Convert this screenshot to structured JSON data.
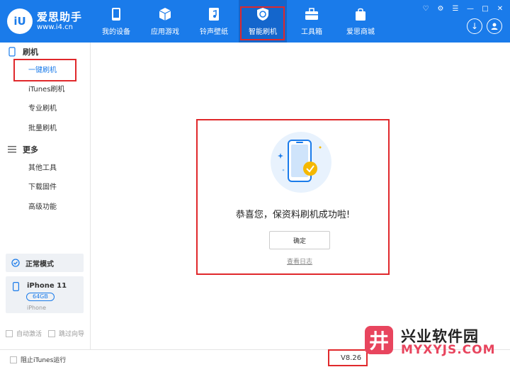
{
  "header": {
    "logo_text": "iU",
    "brand_name": "爱思助手",
    "brand_url": "www.i4.cn",
    "nav": [
      {
        "label": "我的设备",
        "icon": "apple-icon"
      },
      {
        "label": "应用游戏",
        "icon": "cube-icon"
      },
      {
        "label": "铃声壁纸",
        "icon": "music-file-icon"
      },
      {
        "label": "智能刷机",
        "icon": "refresh-shield-icon"
      },
      {
        "label": "工具箱",
        "icon": "toolbox-icon"
      },
      {
        "label": "爱思商城",
        "icon": "shopping-bag-icon"
      }
    ],
    "active_nav": "智能刷机",
    "accent_color": "#1a7bea"
  },
  "sidebar": {
    "section_flash": "刷机",
    "flash_items": [
      "一键刷机",
      "iTunes刷机",
      "专业刷机",
      "批量刷机"
    ],
    "section_more": "更多",
    "more_items": [
      "其他工具",
      "下载固件",
      "高级功能"
    ],
    "mode_label": "正常模式",
    "device_name": "iPhone 11",
    "device_capacity": "64GB",
    "device_type": "iPhone",
    "auto_activate": "自动激活",
    "skip_guide": "跳过向导"
  },
  "main": {
    "result_title": "恭喜您，保资料刷机成功啦!",
    "ok_label": "确定",
    "log_label": "查看日志"
  },
  "bottom": {
    "block_itunes": "阻止iTunes运行",
    "version": "V8.26"
  },
  "watermark": {
    "logo_char": "井",
    "line1": "兴业软件园",
    "line2": "MYXYJS.COM"
  }
}
